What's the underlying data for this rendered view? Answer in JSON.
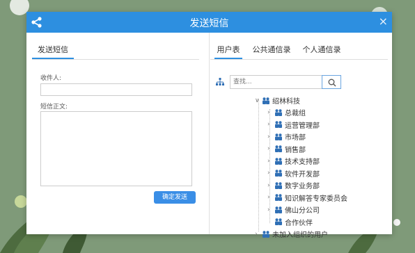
{
  "dialog": {
    "title": "发送短信",
    "icons": {
      "share": "share-icon",
      "close": "close-icon"
    },
    "close_glyph": "×"
  },
  "left_panel": {
    "tab_label": "发送短信",
    "recipient_label": "收件人:",
    "recipient_value": "",
    "body_label": "短信正文:",
    "body_value": "",
    "send_button": "确定发送"
  },
  "right_panel": {
    "tabs": [
      {
        "label": "用户表",
        "active": true
      },
      {
        "label": "公共通信录",
        "active": false
      },
      {
        "label": "个人通信录",
        "active": false
      }
    ],
    "search": {
      "placeholder": "查找...",
      "icon": "search-icon"
    },
    "tree": {
      "root": {
        "label": "绍林科技",
        "expanded": true
      },
      "children": [
        "总裁组",
        "运营管理部",
        "市场部",
        "销售部",
        "技术支持部",
        "软件开发部",
        "数字业务部",
        "知识解答专家委员会",
        "佛山分公司",
        "合作伙伴"
      ],
      "extra": {
        "label": "未加入组织的用户",
        "expanded": false
      }
    }
  },
  "colors": {
    "accent": "#2d8fe0",
    "button": "#3a8ee6",
    "background": "#7f9a79",
    "group_icon": "#2f6fb5"
  }
}
